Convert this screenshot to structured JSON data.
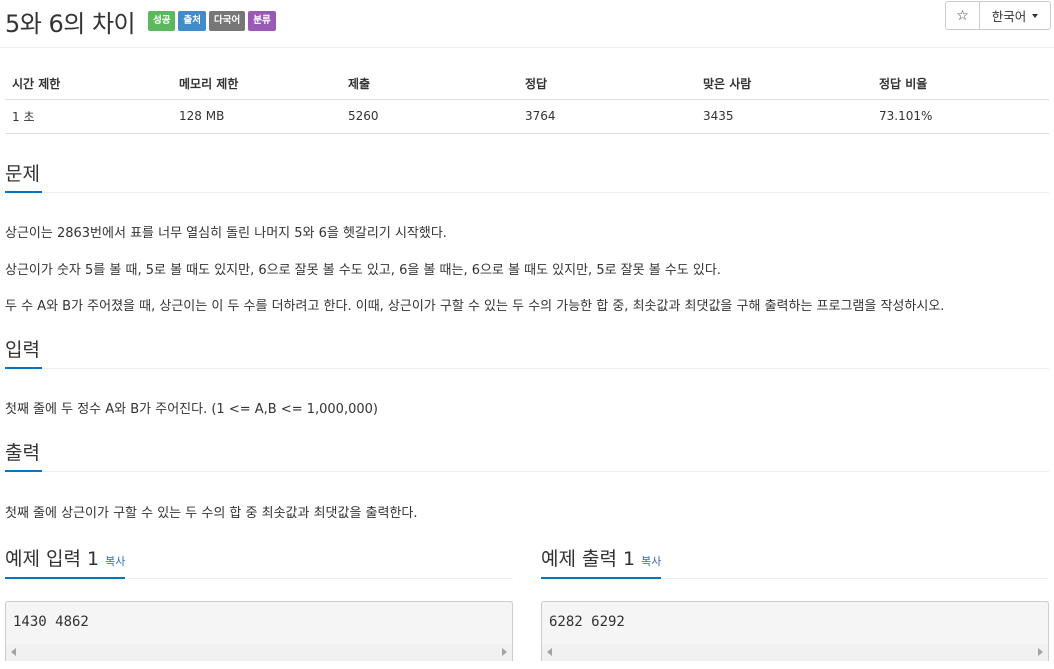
{
  "header": {
    "title": "5와 6의 차이",
    "badges": [
      {
        "label": "성공",
        "color": "#5cb85c"
      },
      {
        "label": "출처",
        "color": "#428bca"
      },
      {
        "label": "다국어",
        "color": "#777777"
      },
      {
        "label": "분류",
        "color": "#9b59b6"
      }
    ],
    "star_icon": "☆",
    "language_label": "한국어"
  },
  "info_table": {
    "headers": [
      "시간 제한",
      "메모리 제한",
      "제출",
      "정답",
      "맞은 사람",
      "정답 비율"
    ],
    "values": [
      "1 초",
      "128 MB",
      "5260",
      "3764",
      "3435",
      "73.101%"
    ]
  },
  "problem": {
    "heading": "문제",
    "paragraphs": [
      "상근이는 2863번에서 표를 너무 열심히 돌린 나머지 5와 6을 헷갈리기 시작했다.",
      "상근이가 숫자 5를 볼 때, 5로 볼 때도 있지만, 6으로 잘못 볼 수도 있고, 6을 볼 때는, 6으로 볼 때도 있지만, 5로 잘못 볼 수도 있다.",
      "두 수 A와 B가 주어졌을 때, 상근이는 이 두 수를 더하려고 한다. 이때, 상근이가 구할 수 있는 두 수의 가능한 합 중, 최솟값과 최댓값을 구해 출력하는 프로그램을 작성하시오."
    ]
  },
  "input": {
    "heading": "입력",
    "text": "첫째 줄에 두 정수 A와 B가 주어진다. (1 <= A,B <= 1,000,000)"
  },
  "output": {
    "heading": "출력",
    "text": "첫째 줄에 상근이가 구할 수 있는 두 수의 합 중 최솟값과 최댓값을 출력한다."
  },
  "samples": {
    "input_heading": "예제 입력 1",
    "output_heading": "예제 출력 1",
    "copy_label": "복사",
    "input_value": "1430 4862",
    "output_value": "6282 6292"
  }
}
